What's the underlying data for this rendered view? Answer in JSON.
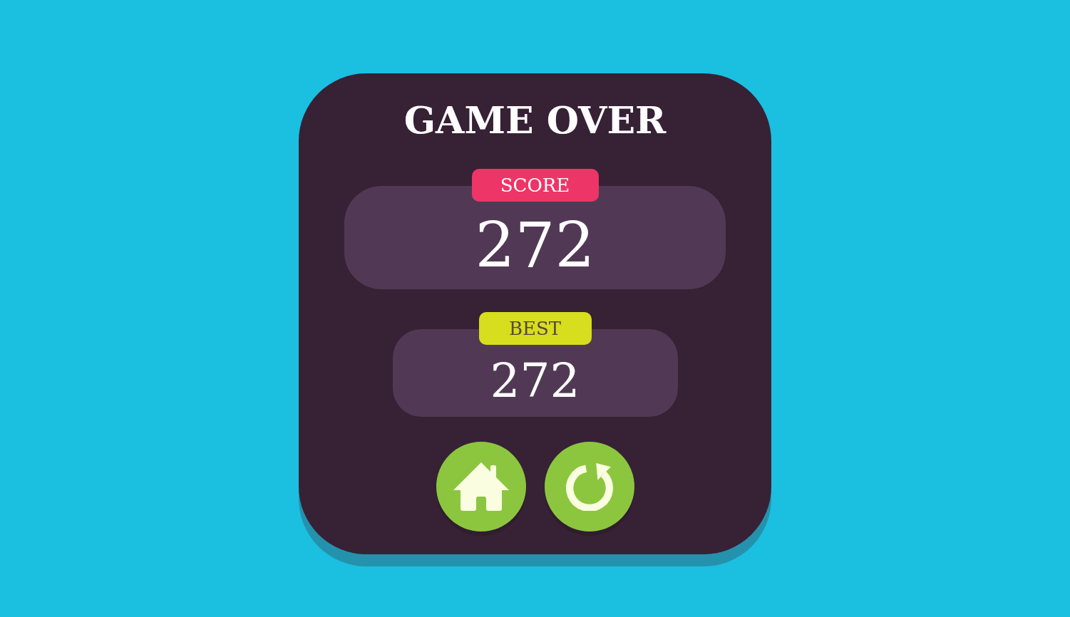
{
  "title": "GAME OVER",
  "score": {
    "label": "SCORE",
    "value": "272"
  },
  "best": {
    "label": "BEST",
    "value": "272"
  },
  "buttons": [
    {
      "kind": "home"
    },
    {
      "kind": "restart"
    }
  ]
}
